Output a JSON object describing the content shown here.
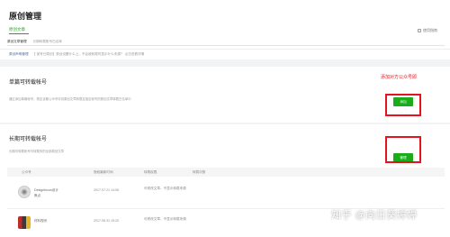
{
  "header": {
    "title": "原创管理",
    "tab": "原创文章",
    "subnav": [
      "原创文章管理",
      "长期转载账号白名单"
    ],
    "help": "使用指南"
  },
  "notice": {
    "lead": "原创声明管理",
    "text": "【 某号已原创】原创设置什么上，不会被转载时显示什么来源？ 点击查看详情"
  },
  "single": {
    "title": "单篇可转载帐号",
    "desc": "通过添加单篇帐号，规定该篇公众号可将原创文章转载至指定帐号的原创文章转载白名单中",
    "add_label": "添加"
  },
  "annotation": {
    "label": "添加对方公众号即"
  },
  "long_term": {
    "title": "长期可转载帐号",
    "desc": "长期可转载帐号可转载你的全部原创文章",
    "manage_label": "管理",
    "columns": [
      "公众号",
      "授权最新时间",
      "转载权限",
      "转载次数"
    ],
    "rows": [
      {
        "name": "Designfocus设计",
        "name_sub": "焦点",
        "time": "2017.07.21 14:06",
        "perm_line1": "可修改文章、不显示转载来源",
        "perm_line2": ""
      },
      {
        "name": "材料视讯",
        "name_sub": "",
        "time": "2017.08.31 15:20",
        "perm_line1": "可修改文章、不显示转载来源",
        "perm_line2": ""
      }
    ]
  },
  "watermark": "知乎 @向日葵婷婷",
  "colors": {
    "accent": "#1aad19",
    "annotation": "#e0161c",
    "link": "#576b95"
  }
}
